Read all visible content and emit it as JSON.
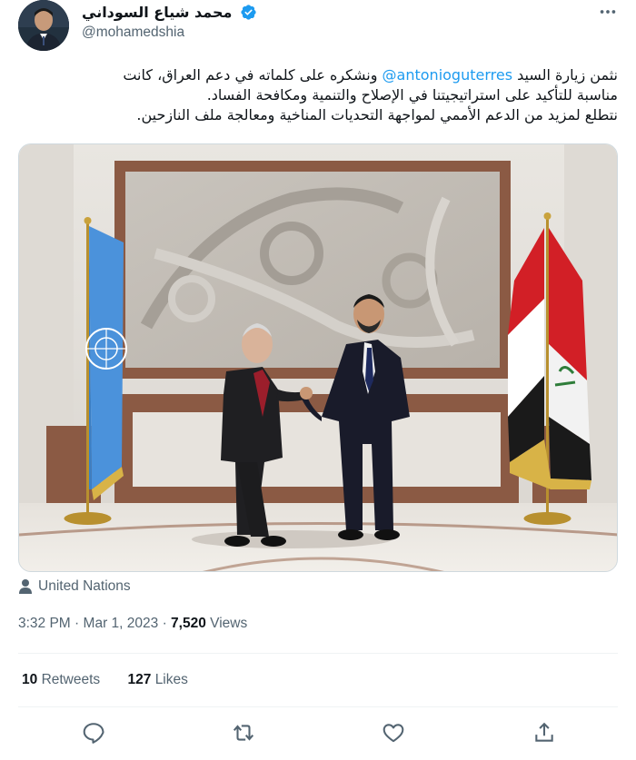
{
  "tweet": {
    "author": {
      "display_name": "محمد شياع السوداني",
      "handle": "@mohamedshia"
    },
    "text": {
      "line1_before": "نثمن زيارة السيد ",
      "mention": "@antonioguterres",
      "line1_after": " ونشكره على كلماته في دعم العراق، كانت",
      "line2": "مناسبة للتأكيد على استراتيجيتنا في الإصلاح والتنمية ومكافحة الفساد.",
      "line3": "نتطلع لمزيد من الدعم الأممي لمواجهة التحديات المناخية ومعالجة ملف النازحين."
    },
    "location": "United Nations",
    "time": "3:32 PM",
    "separator": "·",
    "date": "Mar 1, 2023",
    "views_count": "7,520",
    "views_label": "Views",
    "retweets_count": "10",
    "retweets_label": "Retweets",
    "likes_count": "127",
    "likes_label": "Likes"
  },
  "icons": {
    "verified": "verified-badge-icon",
    "more": "more-dots-icon",
    "location": "location-pin-icon",
    "reply": "reply-icon",
    "retweet": "retweet-icon",
    "like": "like-icon",
    "share": "share-icon"
  },
  "colors": {
    "link": "#1d9bf0",
    "text": "#0f1419",
    "secondary": "#536471",
    "border": "#eff3f4"
  }
}
